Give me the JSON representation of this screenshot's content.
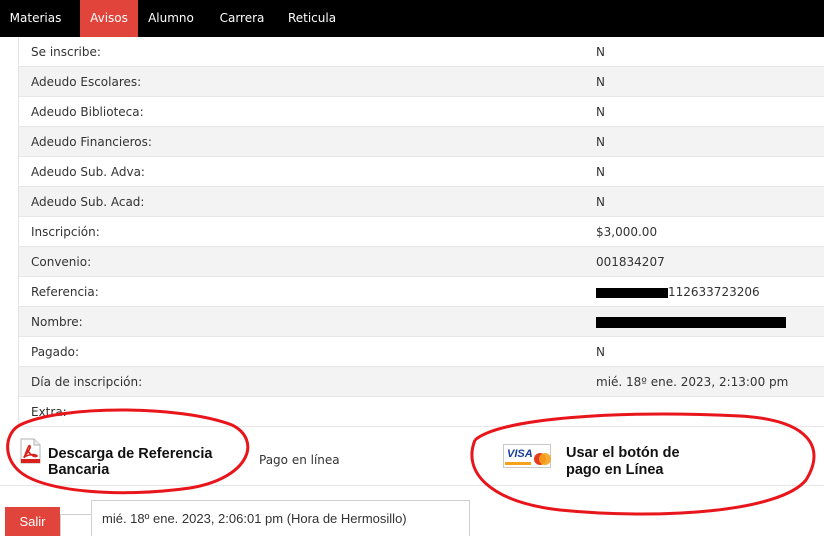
{
  "nav": {
    "tabs": [
      {
        "label": "Materias",
        "active": false
      },
      {
        "label": "Avisos",
        "active": true
      },
      {
        "label": "Alumno",
        "active": false
      },
      {
        "label": "Carrera",
        "active": false
      },
      {
        "label": "Reticula",
        "active": false
      }
    ],
    "accent_color": "#e0443b"
  },
  "info_rows": [
    {
      "label": "Se inscribe:",
      "value": "N"
    },
    {
      "label": "Adeudo Escolares:",
      "value": "N"
    },
    {
      "label": "Adeudo Biblioteca:",
      "value": "N"
    },
    {
      "label": "Adeudo Financieros:",
      "value": "N"
    },
    {
      "label": "Adeudo Sub. Adva:",
      "value": "N"
    },
    {
      "label": "Adeudo Sub. Acad:",
      "value": "N"
    },
    {
      "label": "Inscripción:",
      "value": "$3,000.00"
    },
    {
      "label": "Convenio:",
      "value": "001834207"
    },
    {
      "label": "Referencia:",
      "value": "112633723206"
    },
    {
      "label": "Nombre:",
      "value": ""
    },
    {
      "label": "Pagado:",
      "value": "N"
    },
    {
      "label": "Día de inscripción:",
      "value": "mié. 18º ene. 2023, 2:13:00 pm"
    },
    {
      "label": "Extra:",
      "value": ""
    }
  ],
  "actions": {
    "download_icon": "pdf-icon",
    "download_label": "Descarga de Referencia Bancaria",
    "pago_label": "Pago en línea",
    "visa_icon": "visa-card-icon",
    "visa_brand": "VISA",
    "online_label": "Usar el botón de pago en Línea"
  },
  "footer": {
    "salir_label": "Salir",
    "datetime": "mié. 18º ene. 2023, 2:06:01 pm (Hora de Hermosillo)"
  },
  "annotation_color": "#e8151b"
}
